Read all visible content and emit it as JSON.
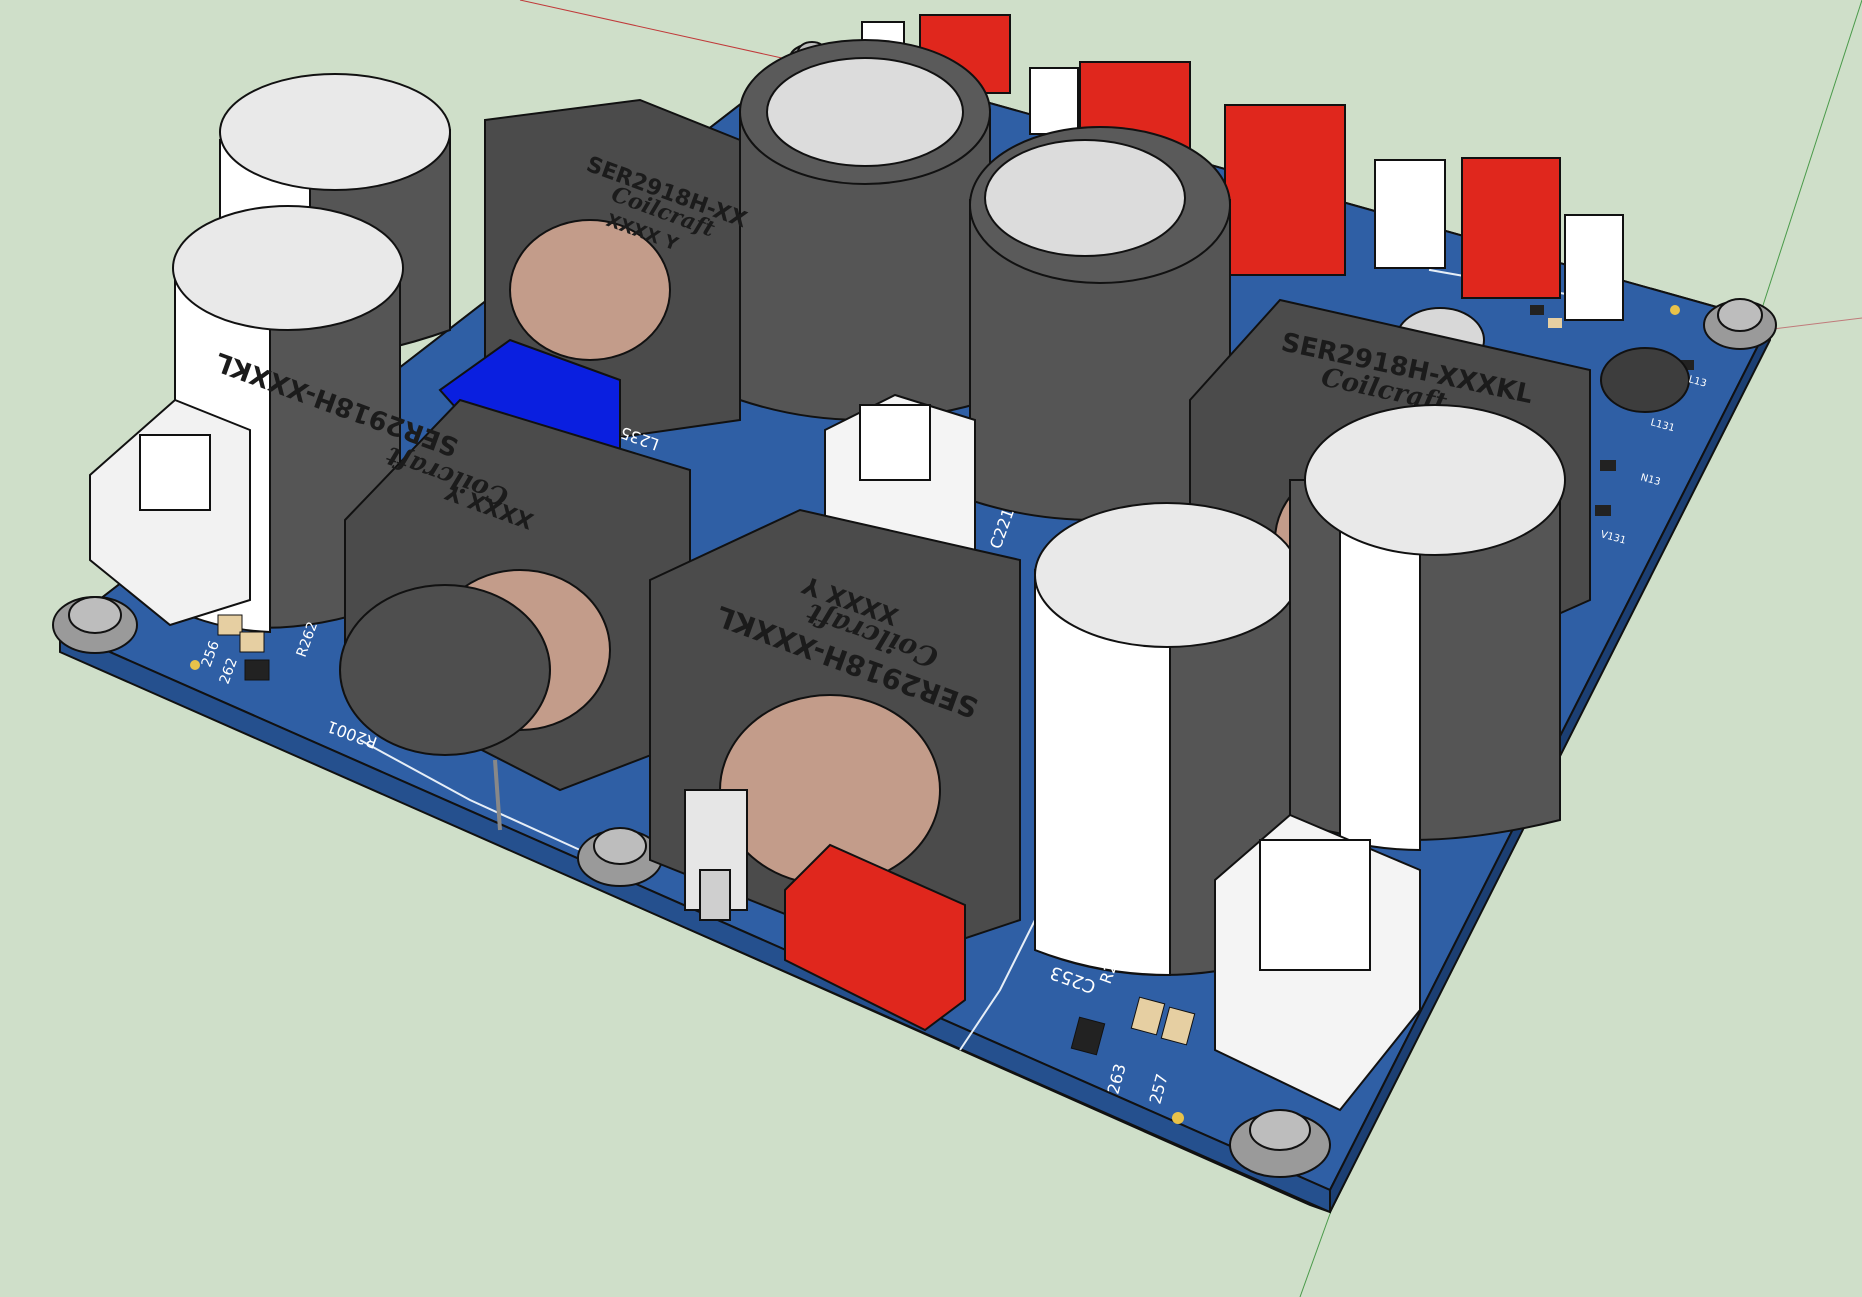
{
  "viewport": {
    "background_color": "#cfdfc9",
    "board_color": "#2f5fa5",
    "pad_color": "#e8c24a"
  },
  "inductors": {
    "part_number": "SER2918H-XXXKL",
    "part_number_partial": "SER2918H-XX",
    "part_number_partial2": "SER2918H-XXXKL",
    "brand": "Coilcraft",
    "date_code": "XXXX Y"
  },
  "silkscreen": {
    "l235": "L235",
    "c221": "C221",
    "c253": "C253",
    "r2001": "R2001",
    "r263": "R263",
    "r262": "R262",
    "num_263": "263",
    "num_257": "257",
    "num_256": "256",
    "num_262": "262"
  },
  "small_labels": {
    "l13": "L13",
    "n13": "N13",
    "l131": "L131",
    "v131": "V131"
  }
}
